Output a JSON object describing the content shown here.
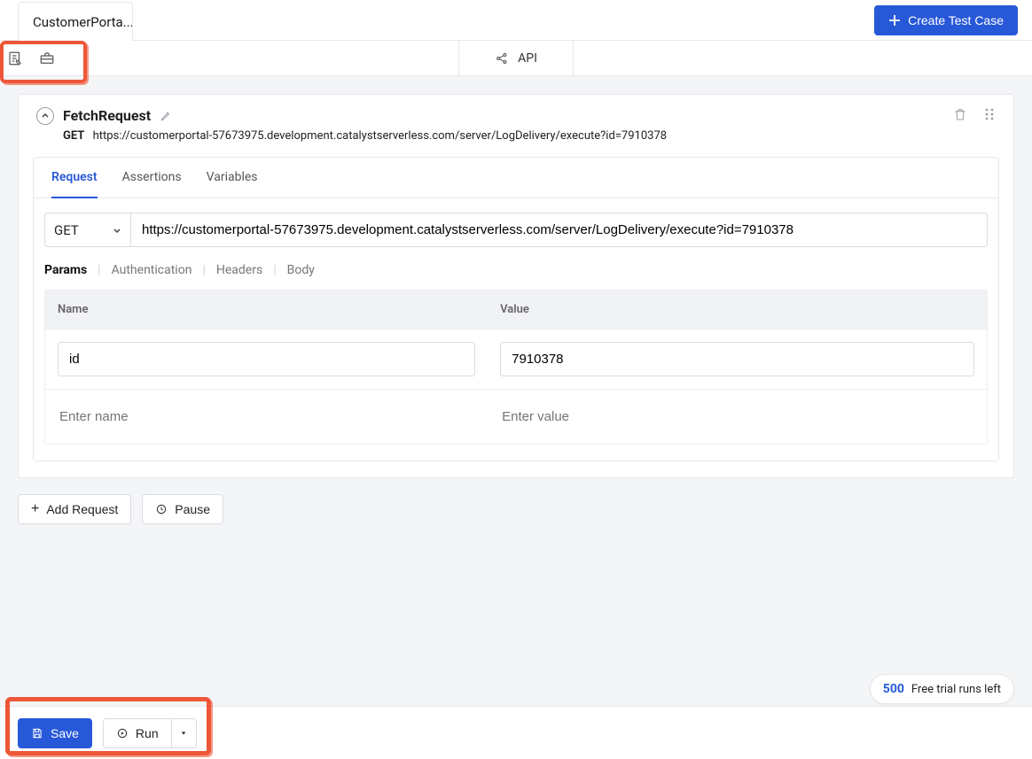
{
  "topbar": {
    "tab_name": "CustomerPorta...",
    "create_label": "Create Test Case"
  },
  "apibar": {
    "label": "API"
  },
  "request_card": {
    "name": "FetchRequest",
    "method": "GET",
    "url_display": "https://customerportal-57673975.development.catalystserverless.com/server/LogDelivery/execute?id=7910378"
  },
  "tabs": {
    "request": "Request",
    "assertions": "Assertions",
    "variables": "Variables"
  },
  "method_select": {
    "value": "GET"
  },
  "url_input": {
    "value": "https://customerportal-57673975.development.catalystserverless.com/server/LogDelivery/execute?id=7910378"
  },
  "subtabs": {
    "params": "Params",
    "authentication": "Authentication",
    "headers": "Headers",
    "body": "Body"
  },
  "params_table": {
    "head_name": "Name",
    "head_value": "Value",
    "rows": [
      {
        "name": "id",
        "value": "7910378"
      }
    ],
    "placeholder_name": "Enter name",
    "placeholder_value": "Enter value"
  },
  "buttons": {
    "add_request": "Add Request",
    "pause": "Pause",
    "save": "Save",
    "run": "Run"
  },
  "trial": {
    "count": "500",
    "label": "Free trial runs left"
  }
}
